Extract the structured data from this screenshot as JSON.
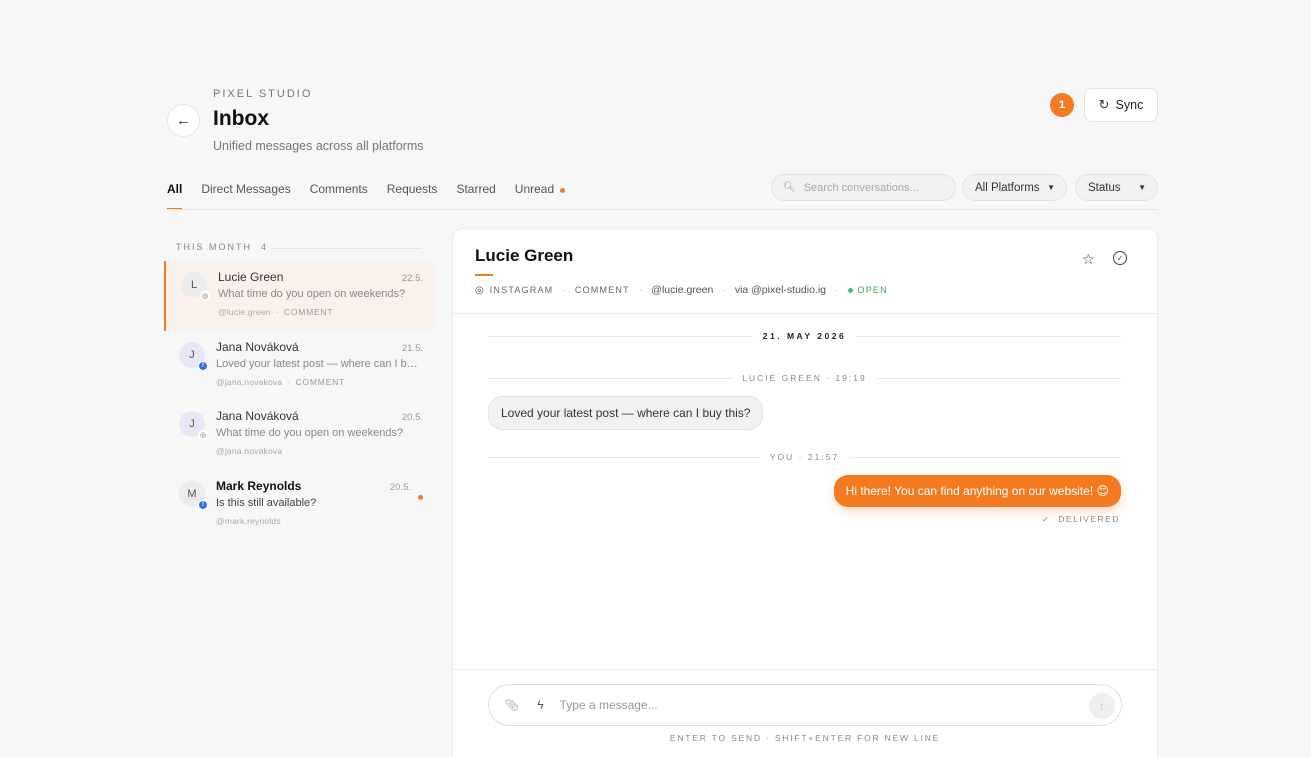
{
  "header": {
    "brand": "PIXEL STUDIO",
    "title": "Inbox",
    "subtitle": "Unified messages across all platforms",
    "notification_count": "1",
    "sync_label": "Sync"
  },
  "tabs": [
    {
      "label": "All",
      "active": true
    },
    {
      "label": "Direct Messages"
    },
    {
      "label": "Comments"
    },
    {
      "label": "Requests"
    },
    {
      "label": "Starred"
    },
    {
      "label": "Unread",
      "dot": true
    }
  ],
  "filters": {
    "search_placeholder": "Search conversations...",
    "platform_label": "All Platforms",
    "status_label": "Status"
  },
  "section": {
    "label": "THIS MONTH",
    "count": "4"
  },
  "conversations": [
    {
      "initial": "L",
      "name": "Lucie Green",
      "date": "22.5.",
      "preview": "What time do you open on weekends?",
      "handle": "@lucie.green",
      "kind": "COMMENT",
      "platform": "instagram",
      "active": true,
      "avatar_color": "#ececec"
    },
    {
      "initial": "J",
      "name": "Jana Nováková",
      "date": "21.5.",
      "preview": "Loved your latest post — where can I buy this?",
      "handle": "@jana.novakova",
      "kind": "COMMENT",
      "platform": "facebook",
      "avatar_color": "#e6e6f6"
    },
    {
      "initial": "J",
      "name": "Jana Nováková",
      "date": "20.5.",
      "preview": "What time do you open on weekends?",
      "handle": "@jana.novakova",
      "kind": "",
      "platform": "instagram",
      "avatar_color": "#e6e6f6"
    },
    {
      "initial": "M",
      "name": "Mark Reynolds",
      "date": "20.5.",
      "preview": "Is this still available?",
      "handle": "@mark.reynolds",
      "kind": "",
      "platform": "facebook",
      "unread": true,
      "avatar_color": "#ececec"
    }
  ],
  "thread": {
    "contact_name": "Lucie Green",
    "platform": "INSTAGRAM",
    "type": "COMMENT",
    "handle": "@lucie.green",
    "via": "via @pixel-studio.ig",
    "status": "OPEN",
    "date_divider": "21. MAY 2026",
    "incoming_label": "LUCIE GREEN · 19:19",
    "incoming_text": "Loved your latest post — where can I buy this?",
    "outgoing_label": "YOU · 21:57",
    "outgoing_text": "Hi there! You can find anything on our website! 😊",
    "delivered": "DELIVERED"
  },
  "composer": {
    "placeholder": "Type a message...",
    "hint": "ENTER TO SEND · SHIFT+ENTER FOR NEW LINE"
  },
  "colors": {
    "accent": "#f47a22",
    "open": "#37c46a"
  }
}
